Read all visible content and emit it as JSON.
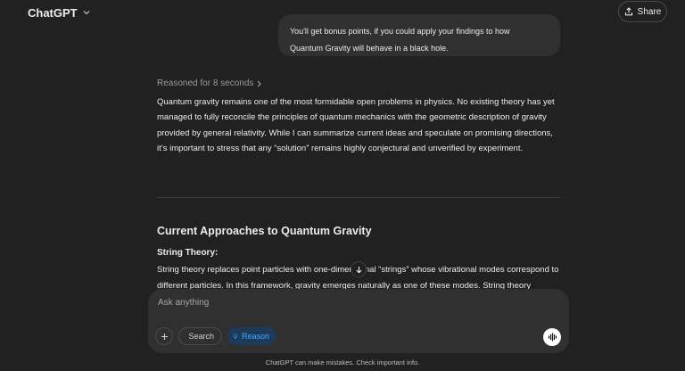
{
  "header": {
    "model_name": "ChatGPT",
    "share_label": "Share"
  },
  "conversation": {
    "user_message_lines": [
      "You'll get bonus points, if you could apply your findings to how",
      "Quantum Gravity will behave in a black hole."
    ],
    "reasoning_label": "Reasoned for 8 seconds",
    "answer_paragraph": "Quantum gravity remains one of the most formidable open problems in physics. No existing theory has yet managed to fully reconcile the principles of quantum mechanics with the geometric description of gravity provided by general relativity. While I can summarize current ideas and speculate on promising directions, it’s important to stress that any “solution” remains highly conjectural and unverified by experiment.",
    "section_heading": "Current Approaches to Quantum Gravity",
    "subheading": "String Theory:",
    "section_body": "String theory replaces point particles with one-dimensional “strings” whose vibrational modes correspond to different particles. In this framework, gravity emerges naturally as one of these modes. String theory"
  },
  "composer": {
    "placeholder": "Ask anything",
    "search_label": "Search",
    "reason_label": "Reason"
  },
  "footer": {
    "disclaimer": "ChatGPT can make mistakes. Check important info."
  },
  "icons": {
    "model_chevron": "chevron-down-icon",
    "share": "share-icon",
    "reasoning_chevron": "chevron-right-icon",
    "scroll": "arrow-down-icon",
    "plus": "plus-icon",
    "search": "globe-icon",
    "reason": "lightbulb-icon",
    "voice": "voice-wave-icon"
  },
  "colors": {
    "background": "#212121",
    "surface": "#303030",
    "reason_accent": "#48aaff",
    "reason_bg": "#1d3a5a"
  }
}
